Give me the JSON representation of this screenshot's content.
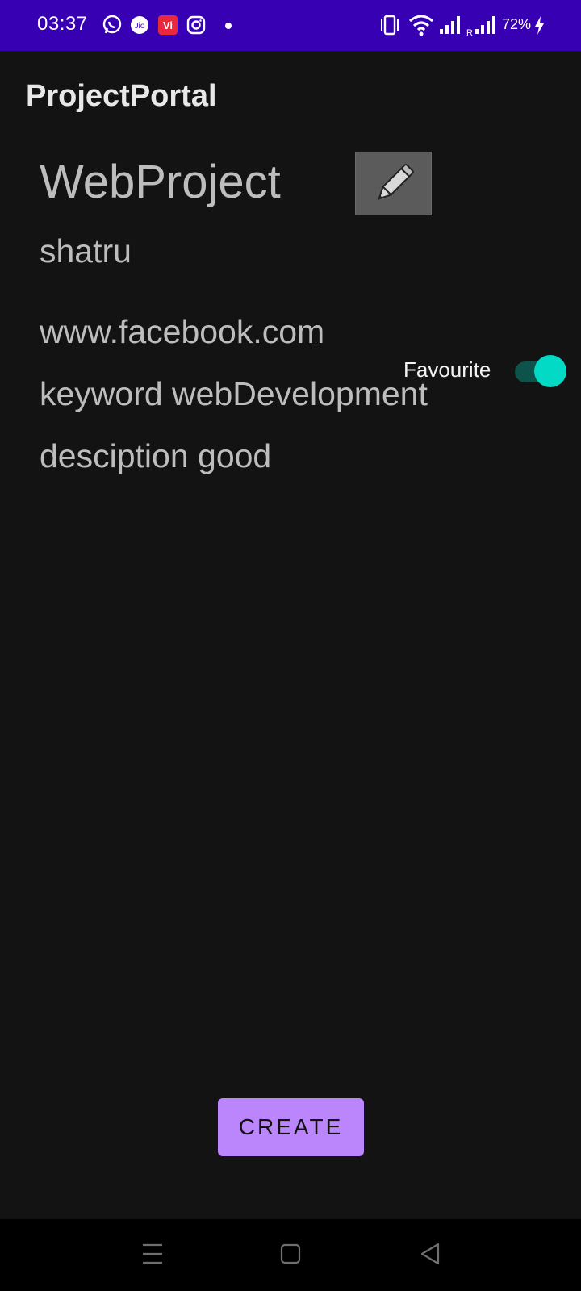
{
  "status_bar": {
    "time": "03:37",
    "battery": "72%",
    "left_icons": [
      "whatsapp-icon",
      "jio-icon",
      "vi-icon",
      "instagram-icon",
      "dot-icon"
    ],
    "right_icons": [
      "vibrate-icon",
      "wifi-icon",
      "signal-icon",
      "signal-roaming-icon",
      "charging-icon"
    ],
    "roaming_label": "R",
    "jio_label": "Jio",
    "vi_label": "Vi",
    "background": "#3700b3"
  },
  "app_bar": {
    "title": "ProjectPortal"
  },
  "project": {
    "name": "WebProject",
    "owner": "shatru",
    "url": "www.facebook.com",
    "keyword": "keyword webDevelopment",
    "description": "desciption good"
  },
  "edit_button": {
    "icon": "pencil-icon"
  },
  "favourite": {
    "label": "Favourite",
    "checked": true,
    "accent": "#03dac5"
  },
  "create_button": {
    "label": "CREATE",
    "color": "#bb86fc"
  },
  "nav_bar": {
    "icons": [
      "menu-icon",
      "home-icon",
      "back-icon"
    ]
  }
}
